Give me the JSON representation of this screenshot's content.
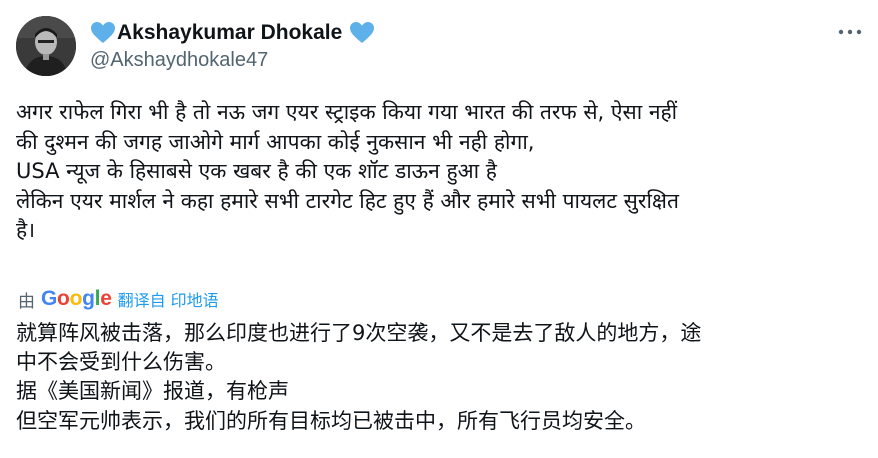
{
  "author": {
    "display_name": "Akshaykumar Dhokale",
    "handle": "@Akshaydhokale47",
    "badge_icon_left": "blue-heart-icon",
    "badge_icon_right": "blue-heart-icon"
  },
  "menu": {
    "icon": "more-horizontal-icon"
  },
  "tweet": {
    "lines": [
      "अगर राफेल गिरा भी है तो नऊ जग एयर स्ट्राइक किया गया भारत की तरफ से, ऐसा नहीं",
      "की दुश्मन की जगह जाओगे मार्ग आपका कोई नुकसान भी नही होगा,",
      "USA न्यूज के हिसाबसे एक खबर है की एक  शॉट डाऊन हुआ है",
      "लेकिन एयर मार्शल ने कहा हमारे सभी टारगेट हिट हुए हैं और हमारे सभी पायलट सुरक्षित",
      "है।"
    ]
  },
  "translation": {
    "by_label": "由",
    "provider_letters": [
      "G",
      "o",
      "o",
      "g",
      "l",
      "e"
    ],
    "provider_colors": [
      "#4285F4",
      "#EA4335",
      "#FBBC05",
      "#4285F4",
      "#34A853",
      "#EA4335"
    ],
    "source_link": "翻译自 印地语",
    "lines": [
      "就算阵风被击落，那么印度也进行了9次空袭，又不是去了敌人的地方，途",
      "中不会受到什么伤害。",
      "据《美国新闻》报道，有枪声",
      "但空军元帅表示，我们的所有目标均已被击中，所有飞行员均安全。"
    ]
  },
  "colors": {
    "text_primary": "#0f1419",
    "text_secondary": "#536471",
    "accent": "#1d9bf0",
    "heart": "#5db0ea"
  }
}
